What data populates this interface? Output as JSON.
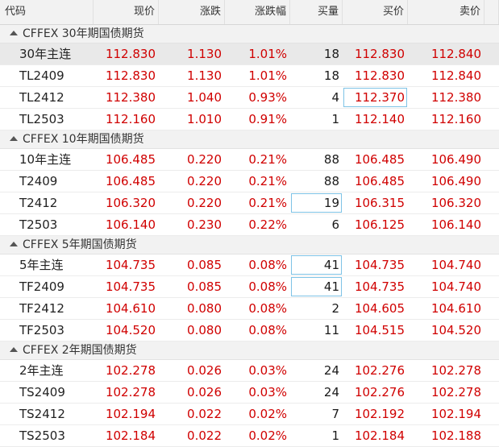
{
  "headers": [
    "代码",
    "现价",
    "涨跌",
    "涨跌幅",
    "买量",
    "买价",
    "卖价"
  ],
  "groups": [
    {
      "title": "CFFEX 30年期国债期货",
      "rows": [
        {
          "code": "30年主连",
          "price": "112.830",
          "change": "1.130",
          "pct": "1.01%",
          "bid_vol": "18",
          "bid": "112.830",
          "ask": "112.840"
        },
        {
          "code": "TL2409",
          "price": "112.830",
          "change": "1.130",
          "pct": "1.01%",
          "bid_vol": "18",
          "bid": "112.830",
          "ask": "112.840"
        },
        {
          "code": "TL2412",
          "price": "112.380",
          "change": "1.040",
          "pct": "0.93%",
          "bid_vol": "4",
          "bid": "112.370",
          "ask": "112.380"
        },
        {
          "code": "TL2503",
          "price": "112.160",
          "change": "1.010",
          "pct": "0.91%",
          "bid_vol": "1",
          "bid": "112.140",
          "ask": "112.160"
        }
      ]
    },
    {
      "title": "CFFEX 10年期国债期货",
      "rows": [
        {
          "code": "10年主连",
          "price": "106.485",
          "change": "0.220",
          "pct": "0.21%",
          "bid_vol": "88",
          "bid": "106.485",
          "ask": "106.490"
        },
        {
          "code": "T2409",
          "price": "106.485",
          "change": "0.220",
          "pct": "0.21%",
          "bid_vol": "88",
          "bid": "106.485",
          "ask": "106.490"
        },
        {
          "code": "T2412",
          "price": "106.320",
          "change": "0.220",
          "pct": "0.21%",
          "bid_vol": "19",
          "bid": "106.315",
          "ask": "106.320"
        },
        {
          "code": "T2503",
          "price": "106.140",
          "change": "0.230",
          "pct": "0.22%",
          "bid_vol": "6",
          "bid": "106.125",
          "ask": "106.140"
        }
      ]
    },
    {
      "title": "CFFEX 5年期国债期货",
      "rows": [
        {
          "code": "5年主连",
          "price": "104.735",
          "change": "0.085",
          "pct": "0.08%",
          "bid_vol": "41",
          "bid": "104.735",
          "ask": "104.740"
        },
        {
          "code": "TF2409",
          "price": "104.735",
          "change": "0.085",
          "pct": "0.08%",
          "bid_vol": "41",
          "bid": "104.735",
          "ask": "104.740"
        },
        {
          "code": "TF2412",
          "price": "104.610",
          "change": "0.080",
          "pct": "0.08%",
          "bid_vol": "2",
          "bid": "104.605",
          "ask": "104.610"
        },
        {
          "code": "TF2503",
          "price": "104.520",
          "change": "0.080",
          "pct": "0.08%",
          "bid_vol": "11",
          "bid": "104.515",
          "ask": "104.520"
        }
      ]
    },
    {
      "title": "CFFEX 2年期国债期货",
      "rows": [
        {
          "code": "2年主连",
          "price": "102.278",
          "change": "0.026",
          "pct": "0.03%",
          "bid_vol": "24",
          "bid": "102.276",
          "ask": "102.278"
        },
        {
          "code": "TS2409",
          "price": "102.278",
          "change": "0.026",
          "pct": "0.03%",
          "bid_vol": "24",
          "bid": "102.276",
          "ask": "102.278"
        },
        {
          "code": "TS2412",
          "price": "102.194",
          "change": "0.022",
          "pct": "0.02%",
          "bid_vol": "7",
          "bid": "102.192",
          "ask": "102.194"
        },
        {
          "code": "TS2503",
          "price": "102.184",
          "change": "0.022",
          "pct": "0.02%",
          "bid_vol": "1",
          "bid": "102.184",
          "ask": "102.188"
        }
      ]
    }
  ],
  "colors": {
    "up": "#d00000",
    "highlight": "#7ec3e6",
    "header_bg": "#f2f2f2",
    "selected_row": "#e9e9e9"
  }
}
